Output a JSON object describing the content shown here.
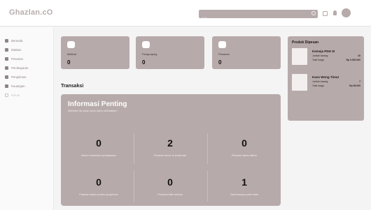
{
  "header": {
    "brand": "Ghazlan.cO",
    "search_placeholder": "Cari"
  },
  "sidebar": {
    "items": [
      {
        "label": "Beranda",
        "icon": "home-icon"
      },
      {
        "label": "Etalase",
        "icon": "grid-icon"
      },
      {
        "label": "Pesanan",
        "icon": "bag-icon"
      },
      {
        "label": "Pembayaran",
        "icon": "card-icon"
      },
      {
        "label": "Pengiriman",
        "icon": "truck-icon"
      },
      {
        "label": "Keuangan",
        "icon": "wallet-icon"
      },
      {
        "label": "Keluar",
        "icon": "logout-icon"
      }
    ]
  },
  "cards": [
    {
      "label": "Melihat",
      "value": "0",
      "icon": "eye-icon"
    },
    {
      "label": "Pengunjung",
      "value": "0",
      "icon": "user-icon"
    },
    {
      "label": "Pesanan",
      "value": "0",
      "icon": "shopping-bag-icon"
    }
  ],
  "section": {
    "title": "Transaksi"
  },
  "panel": {
    "title": "Informasi Penting",
    "subtitle": "Aktivitas hal yang harus kamu selesaikan !",
    "stats": [
      {
        "value": "0",
        "label": "Belum melakukan pembayaran"
      },
      {
        "value": "2",
        "label": "Pesanan belum di konfirmasi"
      },
      {
        "value": "0",
        "label": "Pesanan dalam dikirim"
      },
      {
        "value": "0",
        "label": "Pesanan dalam proses pengiriman"
      },
      {
        "value": "0",
        "label": "Pesanan telah selesai"
      },
      {
        "value": "1",
        "label": "Obat barang sudah habis"
      }
    ]
  },
  "orders": {
    "title": "Produk Dipesan",
    "items": [
      {
        "name": "Kemeja PDH SI",
        "qty_label": "Jumlah barang",
        "qty": "20",
        "total_label": "Total harga",
        "total": "Rp 3.000.000"
      },
      {
        "name": "Kaos Wong Timur",
        "qty_label": "Jumlah barang",
        "qty": "7",
        "total_label": "Total harga",
        "total": "Rp 65.000"
      }
    ]
  },
  "colors": {
    "accent": "#b7aaaa",
    "brand_text": "#b9aeae",
    "background": "#f5f4f4"
  }
}
